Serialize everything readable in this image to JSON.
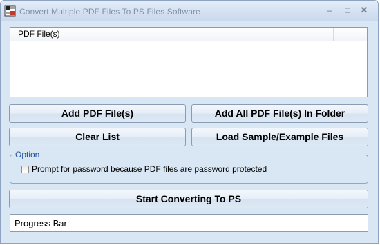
{
  "window": {
    "title": "Convert Multiple PDF Files To PS Files Software",
    "controls": {
      "minimize": "–",
      "maximize": "□",
      "close": "✕"
    },
    "icon": "app-icon"
  },
  "file_list": {
    "columns": [
      "PDF File(s)"
    ],
    "rows": []
  },
  "buttons": {
    "add_files": "Add PDF File(s)",
    "add_folder": "Add All PDF File(s) In Folder",
    "clear_list": "Clear List",
    "load_sample": "Load Sample/Example Files",
    "start": "Start Converting To PS"
  },
  "option": {
    "legend": "Option",
    "password_prompt": {
      "label": "Prompt for password because PDF files are password protected",
      "checked": false
    }
  },
  "progress": {
    "label": "Progress Bar"
  },
  "colors": {
    "window_bg": "#d9e6f4",
    "legend_text": "#1e4f9e",
    "border": "#8a9bb3"
  }
}
